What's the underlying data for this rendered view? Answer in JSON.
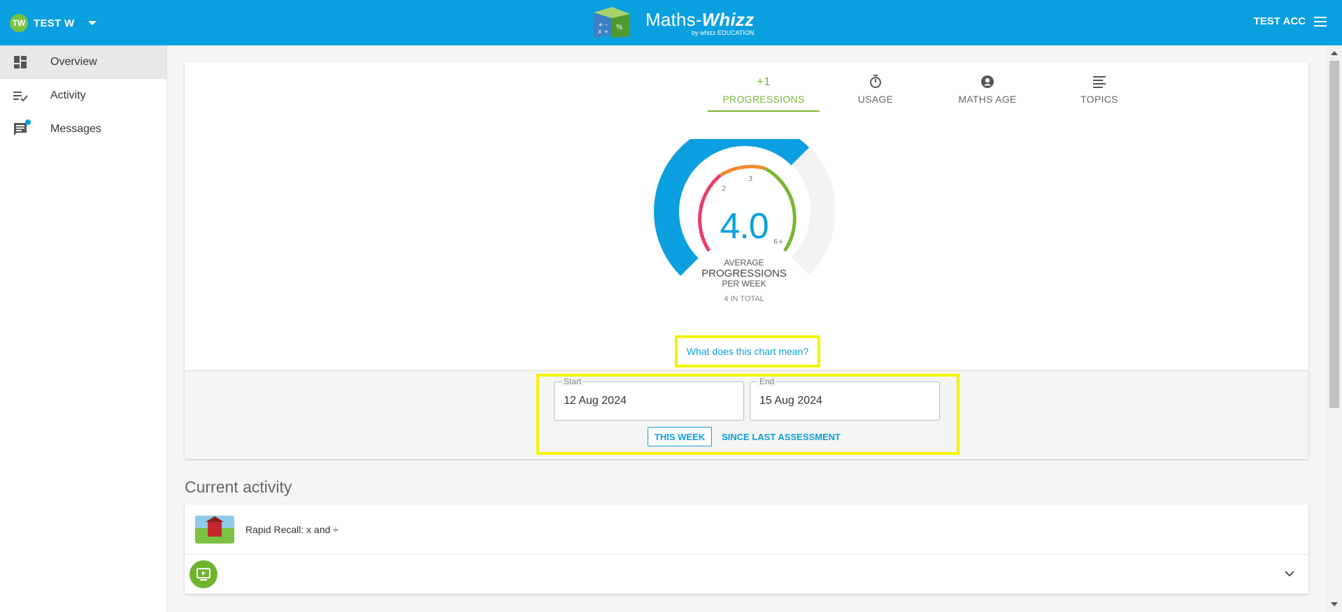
{
  "header": {
    "user_initials": "TW",
    "user_name": "TEST W",
    "logo_main": "Maths-",
    "logo_bold": "Whizz",
    "logo_sub": "by whizz EDUCATION",
    "account_name": "TEST ACC"
  },
  "sidebar": {
    "items": [
      {
        "label": "Overview",
        "icon": "dashboard-icon",
        "active": true
      },
      {
        "label": "Activity",
        "icon": "checklist-icon"
      },
      {
        "label": "Messages",
        "icon": "message-icon",
        "has_unread": true
      }
    ]
  },
  "tabs": [
    {
      "top": "+1",
      "label": "PROGRESSIONS",
      "active": true
    },
    {
      "top_icon": "timer-icon",
      "label": "USAGE"
    },
    {
      "top_icon": "person-icon",
      "label": "MATHS AGE"
    },
    {
      "top_icon": "list-icon",
      "label": "TOPICS"
    }
  ],
  "gauge": {
    "value": "4.0",
    "numeric_value": 4.0,
    "scale_labels": [
      "2",
      "3",
      "6+"
    ],
    "caption_line1": "AVERAGE",
    "caption_line2": "PROGRESSIONS",
    "caption_line3": "PER WEEK",
    "total": "4 IN TOTAL",
    "colors": {
      "fill": "#0aa0e0",
      "track": "#f2f2f2",
      "low": "#e83e6c",
      "mid": "#f08a30",
      "high": "#7ab533"
    }
  },
  "help_link": "What does this chart mean?",
  "date_range": {
    "start_label": "Start",
    "start_value": "12 Aug 2024",
    "end_label": "End",
    "end_value": "15 Aug 2024",
    "this_week": "THIS WEEK",
    "since_assessment": "SINCE LAST ASSESSMENT"
  },
  "current_activity": {
    "title": "Current activity",
    "item_title": "Rapid Recall: x and ÷"
  },
  "colors": {
    "brand": "#0aa0e0",
    "accent": "#7ab533",
    "highlight": "#f3f300"
  }
}
